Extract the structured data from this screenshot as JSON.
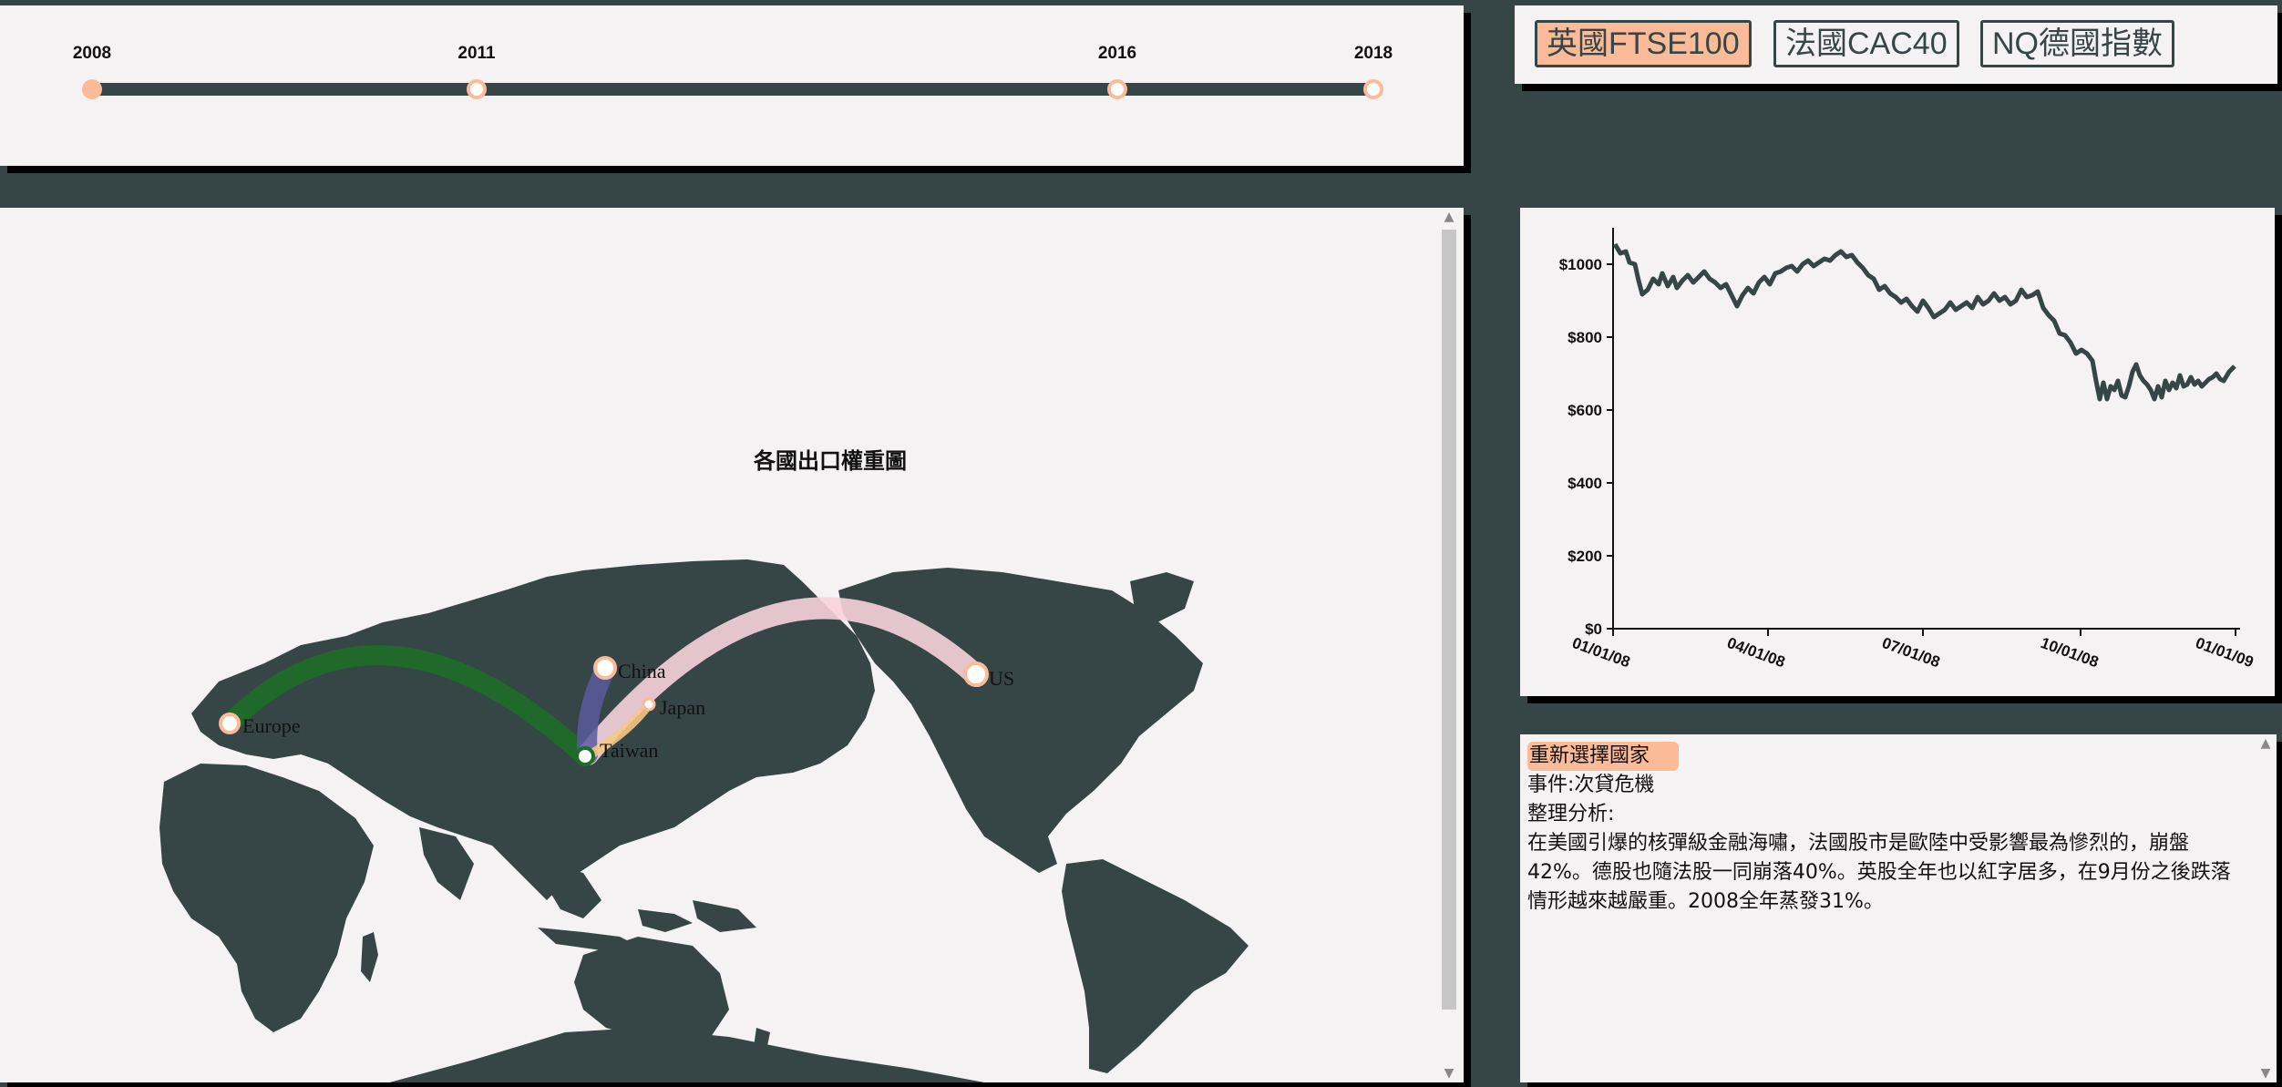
{
  "timeline": {
    "years": [
      "2008",
      "2011",
      "2016",
      "2018"
    ],
    "selected_year": "2008"
  },
  "index_buttons": [
    {
      "label": "英國FTSE100",
      "active": true
    },
    {
      "label": "法國CAC40",
      "active": false
    },
    {
      "label": "NQ德國指數",
      "active": false
    }
  ],
  "map": {
    "title": "各國出口權重圖",
    "places": {
      "europe": "Europe",
      "china": "China",
      "japan": "Japan",
      "taiwan": "Taiwan",
      "us": "US"
    },
    "flow_colors": {
      "europe": "#1f6b2a",
      "china": "#5a5a9e",
      "japan": "#f5c784",
      "us": "#f8d3dc"
    }
  },
  "price_chart": {
    "y_ticks": [
      "$0",
      "$200",
      "$400",
      "$600",
      "$800",
      "$1000"
    ],
    "x_ticks": [
      "01/01/08",
      "04/01/08",
      "07/01/08",
      "10/01/08",
      "01/01/09"
    ],
    "line_color": "#364545"
  },
  "analysis": {
    "reselect_label": "重新選擇國家",
    "event_line": "事件:次貸危機",
    "heading": "整理分析:",
    "body": "在美國引爆的核彈級金融海嘯，法國股市是歐陸中受影響最為慘烈的，崩盤42%。德股也隨法股一同崩落40%。英股全年也以紅字居多，在9月份之後跌落情形越來越嚴重。2008全年蒸發31%。"
  },
  "colors": {
    "accent": "#fcbb98",
    "dark": "#364545",
    "panel": "#f5f2f3"
  }
}
